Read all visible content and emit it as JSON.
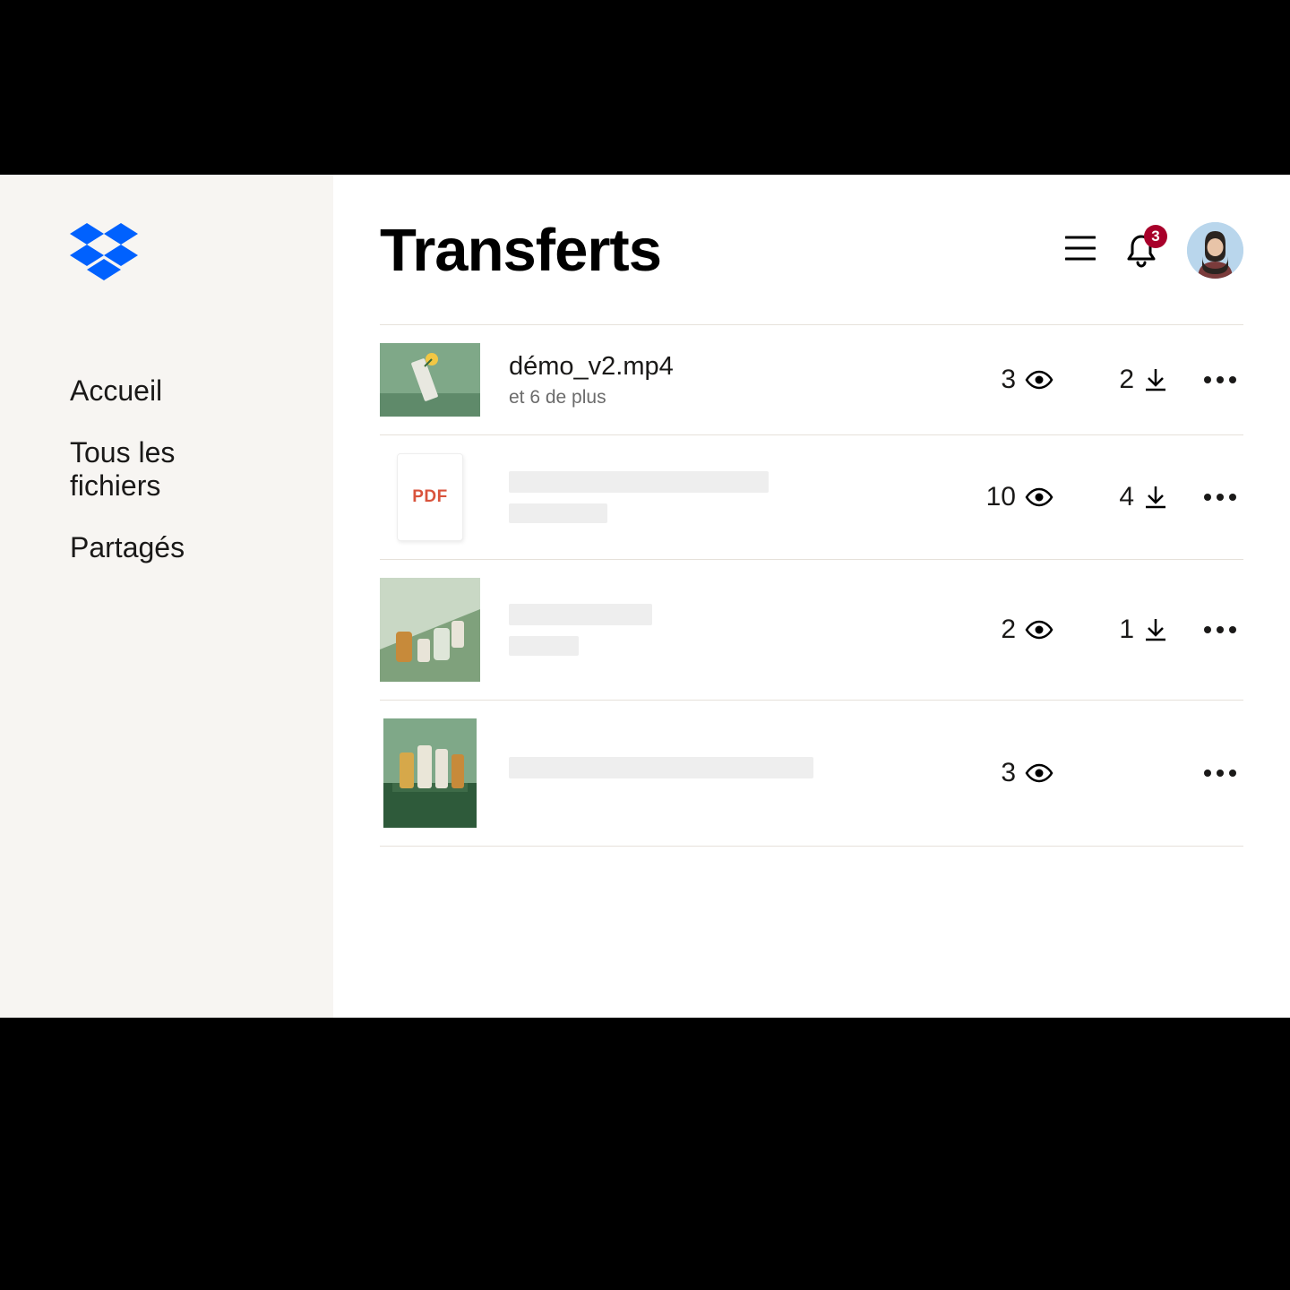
{
  "brand": {
    "name": "Dropbox"
  },
  "sidebar": {
    "items": [
      {
        "label": "Accueil"
      },
      {
        "label": "Tous les fichiers"
      },
      {
        "label": "Partagés"
      }
    ]
  },
  "header": {
    "title": "Transferts",
    "notification_count": "3"
  },
  "pdf_label": "PDF",
  "transfers": [
    {
      "name": "démo_v2.mp4",
      "subtitle": "et 6 de plus",
      "views": "3",
      "downloads": "2",
      "thumb_type": "image_wide_green",
      "has_download": true,
      "placeholder": false
    },
    {
      "name": "",
      "subtitle": "",
      "views": "10",
      "downloads": "4",
      "thumb_type": "pdf",
      "has_download": true,
      "placeholder": true,
      "placeholder_style": "two-lines-a"
    },
    {
      "name": "",
      "subtitle": "",
      "views": "2",
      "downloads": "1",
      "thumb_type": "image_square_bottles",
      "has_download": true,
      "placeholder": true,
      "placeholder_style": "two-lines-b"
    },
    {
      "name": "",
      "subtitle": "",
      "views": "3",
      "downloads": "",
      "thumb_type": "image_tall_bottles",
      "has_download": false,
      "placeholder": true,
      "placeholder_style": "one-line"
    }
  ]
}
